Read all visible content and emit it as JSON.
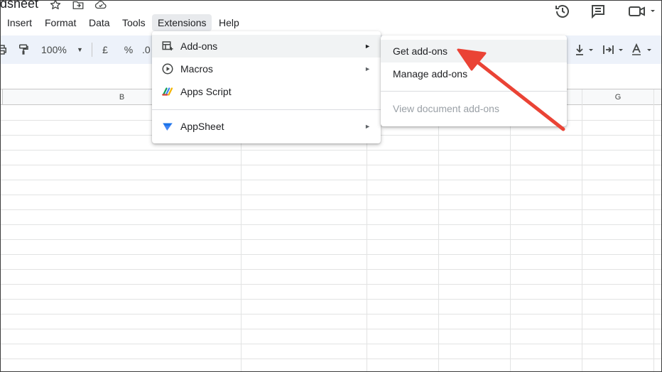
{
  "doc": {
    "title": "dsheet"
  },
  "menubar": {
    "items": [
      {
        "label": "Insert"
      },
      {
        "label": "Format"
      },
      {
        "label": "Data"
      },
      {
        "label": "Tools"
      },
      {
        "label": "Extensions"
      },
      {
        "label": "Help"
      }
    ]
  },
  "toolbar": {
    "zoom": "100%",
    "currency": "£",
    "percent": "%",
    "decimal": ".0"
  },
  "columns": [
    "B",
    "G"
  ],
  "extensions_menu": {
    "items": [
      {
        "label": "Add-ons",
        "icon": "addons-icon",
        "has_submenu": true
      },
      {
        "label": "Macros",
        "icon": "macros-icon",
        "has_submenu": true
      },
      {
        "label": "Apps Script",
        "icon": "apps-script-icon",
        "has_submenu": false
      },
      {
        "label": "AppSheet",
        "icon": "appsheet-icon",
        "has_submenu": true
      }
    ],
    "arrow": "►"
  },
  "addons_submenu": {
    "items": [
      {
        "label": "Get add-ons",
        "disabled": false
      },
      {
        "label": "Manage add-ons",
        "disabled": false
      },
      {
        "label": "View document add-ons",
        "disabled": true
      }
    ]
  },
  "colors": {
    "toolbar_bg": "#edf2fa",
    "annotation_arrow": "#ea4335",
    "appsheet_blue": "#4285f4"
  }
}
